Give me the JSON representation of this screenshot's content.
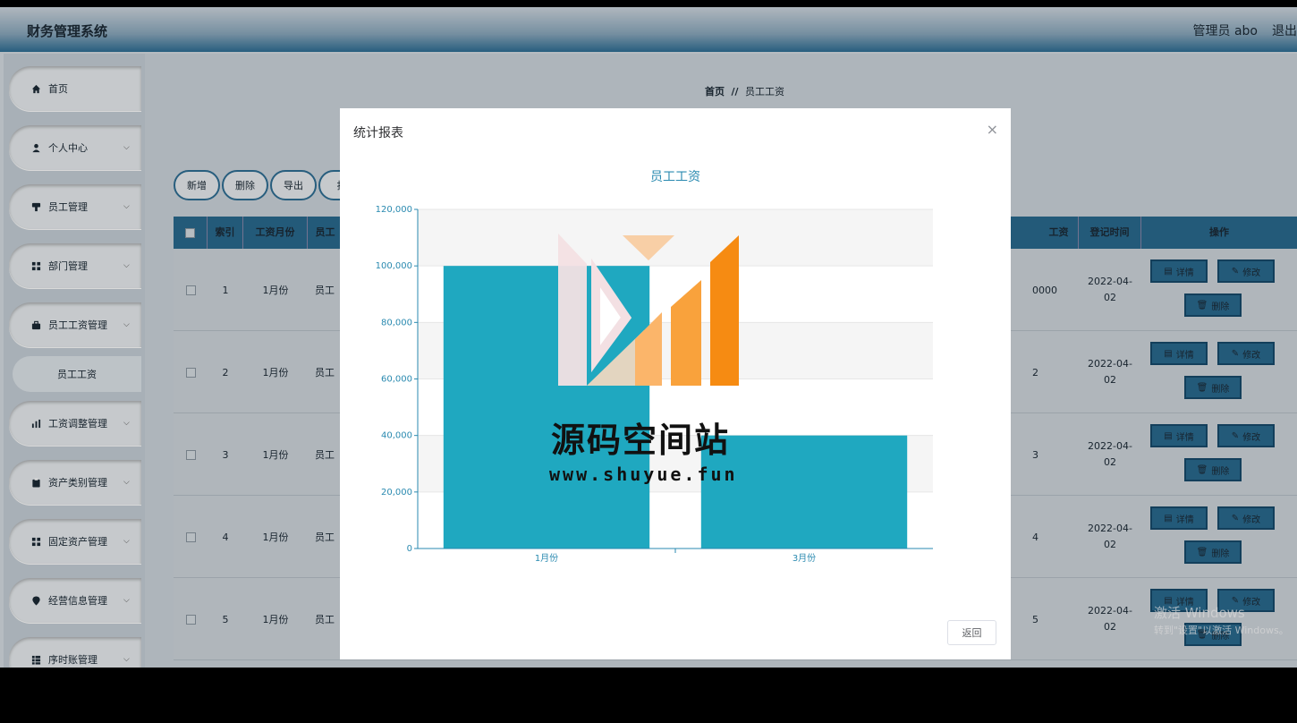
{
  "header": {
    "app_title": "财务管理系统",
    "admin_label": "管理员 abo",
    "logout_label": "退出"
  },
  "sidebar": {
    "items": [
      {
        "label": "首页",
        "icon": "home-icon"
      },
      {
        "label": "个人中心",
        "icon": "user-icon"
      },
      {
        "label": "员工管理",
        "icon": "badge-icon"
      },
      {
        "label": "部门管理",
        "icon": "grid-icon"
      },
      {
        "label": "员工工资管理",
        "icon": "briefcase-icon"
      },
      {
        "label": "工资调整管理",
        "icon": "bar-chart-icon"
      },
      {
        "label": "资产类别管理",
        "icon": "clipboard-icon"
      },
      {
        "label": "固定资产管理",
        "icon": "grid-icon"
      },
      {
        "label": "经营信息管理",
        "icon": "pin-icon"
      },
      {
        "label": "序时账管理",
        "icon": "table-icon"
      }
    ],
    "sub_item": "员工工资"
  },
  "breadcrumb": {
    "home": "首页",
    "sep": "//",
    "current": "员工工资"
  },
  "toolbar": {
    "add": "新增",
    "delete": "删除",
    "export": "导出",
    "print": "打"
  },
  "table": {
    "headers": {
      "index": "索引",
      "month": "工资月份",
      "employee": "员工",
      "salary": "工资",
      "time": "登记时间",
      "ops": "操作"
    },
    "rows": [
      {
        "index": "1",
        "month": "1月份",
        "employee": "员工",
        "salary": "0000",
        "date1": "2022-04-",
        "date2": "02"
      },
      {
        "index": "2",
        "month": "1月份",
        "employee": "员工",
        "salary": "2",
        "date1": "2022-04-",
        "date2": "02"
      },
      {
        "index": "3",
        "month": "1月份",
        "employee": "员工",
        "salary": "3",
        "date1": "2022-04-",
        "date2": "02"
      },
      {
        "index": "4",
        "month": "1月份",
        "employee": "员工",
        "salary": "4",
        "date1": "2022-04-",
        "date2": "02"
      },
      {
        "index": "5",
        "month": "1月份",
        "employee": "员工",
        "salary": "5",
        "date1": "2022-04-",
        "date2": "02"
      }
    ],
    "op_labels": {
      "detail": "详情",
      "edit": "修改",
      "remove": "删除"
    }
  },
  "windows_activation": {
    "line1": "激活 Windows",
    "line2": "转到\"设置\"以激活 Windows。"
  },
  "modal": {
    "title": "统计报表",
    "close": "×",
    "return_label": "返回"
  },
  "watermark": {
    "text": "源码空间站",
    "url": "www.shuyue.fun"
  },
  "chart_data": {
    "type": "bar",
    "title": "员工工资",
    "categories": [
      "1月份",
      "3月份"
    ],
    "values": [
      100000,
      40000
    ],
    "ylim": [
      0,
      120000
    ],
    "yticks": [
      0,
      20000,
      40000,
      60000,
      80000,
      100000,
      120000
    ],
    "ytick_labels": [
      "0",
      "20,000",
      "40,000",
      "60,000",
      "80,000",
      "100,000",
      "120,000"
    ],
    "xlabel": "",
    "ylabel": "",
    "bar_color": "#1fa8c0",
    "axis_color": "#2a8ab0",
    "grid": true
  }
}
